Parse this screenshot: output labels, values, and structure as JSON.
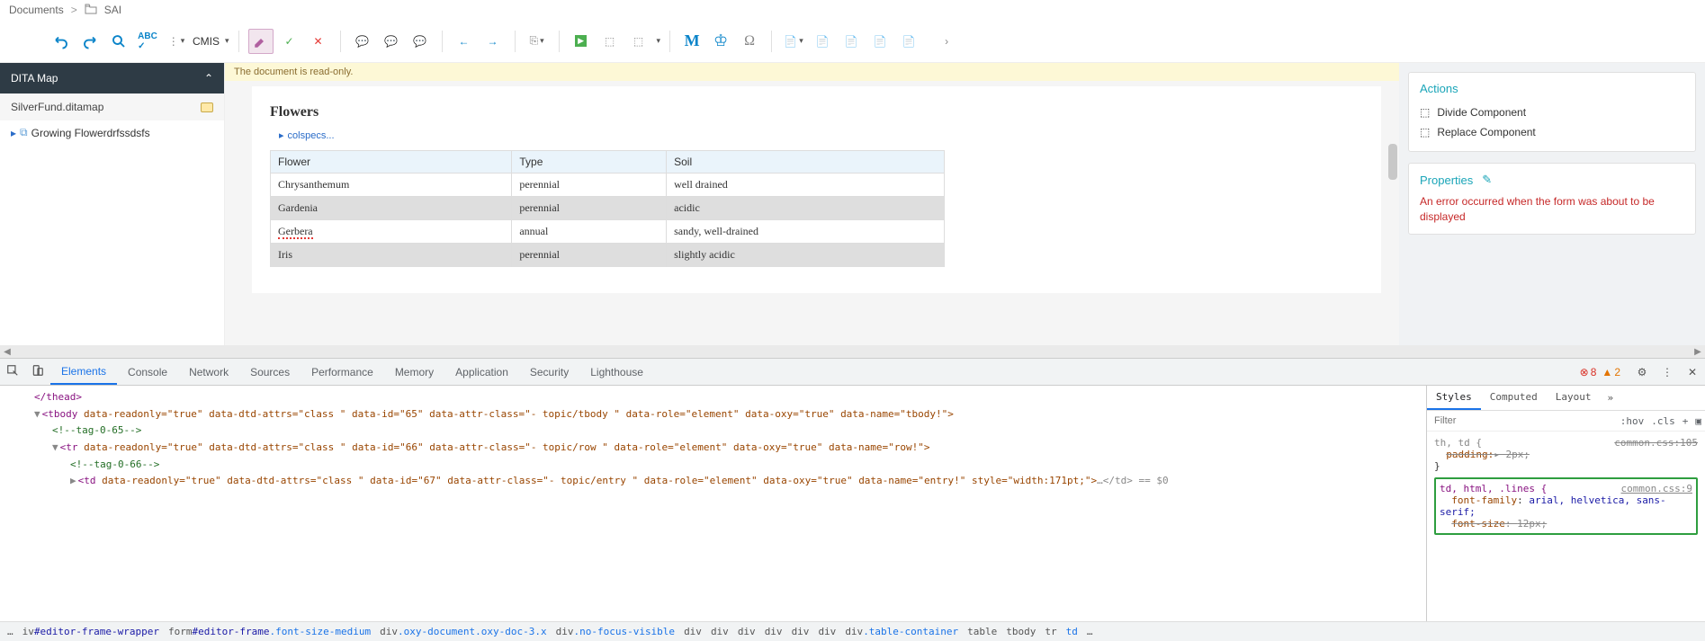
{
  "breadcrumb": {
    "root": "Documents",
    "current": "SAI"
  },
  "toolbar": {
    "cmis_label": "CMIS"
  },
  "left_panel": {
    "dita_map_title": "DITA Map",
    "ditamap_file": "SilverFund.ditamap",
    "tree_root": "Growing Flowerdrfssdsfs"
  },
  "editor": {
    "readonly_msg": "The document is read-only.",
    "title": "Flowers",
    "colspecs_label": "colspecs...",
    "table": {
      "headers": [
        "Flower",
        "Type",
        "Soil"
      ],
      "rows": [
        [
          "Chrysanthemum",
          "perennial",
          "well drained"
        ],
        [
          "Gardenia",
          "perennial",
          "acidic"
        ],
        [
          "Gerbera",
          "annual",
          "sandy, well-drained"
        ],
        [
          "Iris",
          "perennial",
          "slightly acidic"
        ]
      ]
    }
  },
  "right_panel": {
    "actions_title": "Actions",
    "divide": "Divide Component",
    "replace": "Replace Component",
    "properties_title": "Properties",
    "error": "An error occurred when the form was about to be displayed"
  },
  "devtools": {
    "tabs": [
      "Elements",
      "Console",
      "Network",
      "Sources",
      "Performance",
      "Memory",
      "Application",
      "Security",
      "Lighthouse"
    ],
    "err_count": "8",
    "warn_count": "2",
    "styles_tabs": [
      "Styles",
      "Computed",
      "Layout"
    ],
    "filter_placeholder": "Filter",
    "hov": ":hov",
    "cls": ".cls",
    "rule_strike": {
      "selector": "th, td {",
      "prop1": "padding:",
      "val1": "2px;",
      "close": "}",
      "source": "common.css:105"
    },
    "rule_hl": {
      "selector": "td, html, .lines {",
      "p1": "font-family",
      "v1": "arial, helvetica, sans-serif;",
      "p2": "font-size",
      "v2": "12px;",
      "source": "common.css:9"
    },
    "html": {
      "l1": "</thead>",
      "l2_pre": "<tbody",
      "l2_attrs": " data-readonly=\"true\" data-dtd-attrs=\"class \" data-id=\"65\" data-attr-class=\"- topic/tbody \" data-role=\"element\" data-oxy=\"true\" data-name=\"tbody!\">",
      "l3": "<!--tag-0-65-->",
      "l4_pre": "<tr",
      "l4_attrs": " data-readonly=\"true\" data-dtd-attrs=\"class \" data-id=\"66\" data-attr-class=\"- topic/row \" data-role=\"element\" data-oxy=\"true\" data-name=\"row!\">",
      "l5": "<!--tag-0-66-->",
      "l6_pre": "<td",
      "l6_attrs": " data-readonly=\"true\" data-dtd-attrs=\"class \" data-id=\"67\" data-attr-class=\"- topic/entry \" data-role=\"element\" data-oxy=\"true\" data-name=\"entry!\" style=\"width:171pt;\">",
      "l6_end": "…</td> == $0"
    },
    "crumbs": [
      "…",
      "iv#editor-frame-wrapper",
      "form#editor-frame.font-size-medium",
      "div.oxy-document.oxy-doc-3.x",
      "div.no-focus-visible",
      "div",
      "div",
      "div",
      "div",
      "div",
      "div",
      "div.table-container",
      "table",
      "tbody",
      "tr",
      "td",
      "…"
    ]
  }
}
